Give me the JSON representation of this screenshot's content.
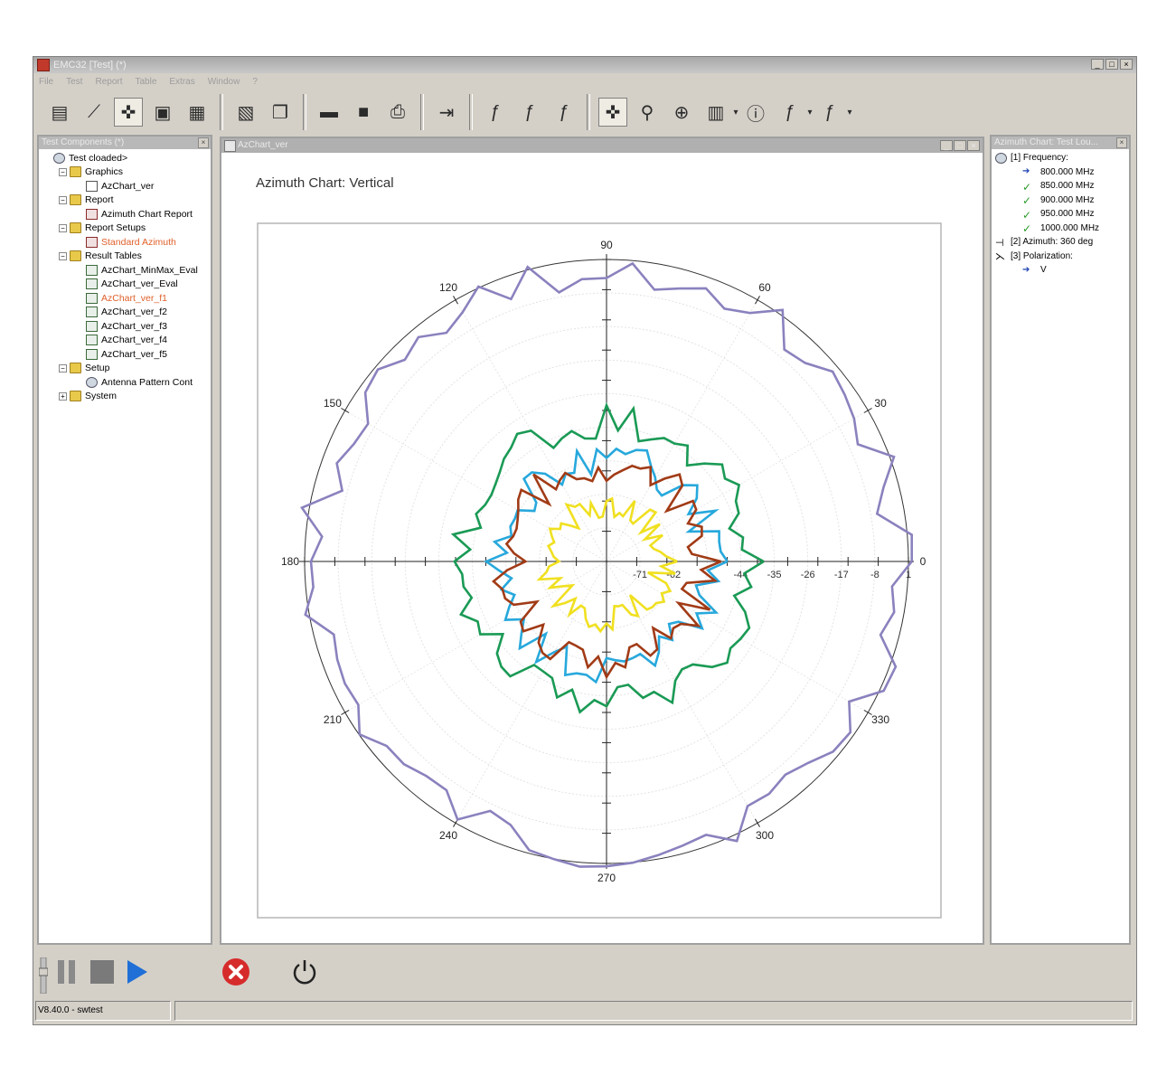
{
  "window": {
    "title": "EMC32 [Test] (*)"
  },
  "menu": [
    "File",
    "Test",
    "Report",
    "Table",
    "Extras",
    "Window",
    "?"
  ],
  "left_panel": {
    "title": "Test Components (*)",
    "items": [
      {
        "label": "Test cloaded>",
        "level": 0,
        "icon": "globe-icon",
        "toggle": ""
      },
      {
        "label": "Graphics",
        "level": 1,
        "icon": "folder-icon",
        "toggle": "−"
      },
      {
        "label": "AzChart_ver",
        "level": 2,
        "icon": "graphic-icon",
        "toggle": ""
      },
      {
        "label": "Report",
        "level": 1,
        "icon": "folder-icon",
        "toggle": "−"
      },
      {
        "label": "Azimuth Chart Report",
        "level": 2,
        "icon": "report-icon",
        "toggle": ""
      },
      {
        "label": "Report Setups",
        "level": 1,
        "icon": "folder-icon",
        "toggle": "−"
      },
      {
        "label": "Standard Azimuth",
        "level": 2,
        "icon": "report-setup-icon",
        "toggle": "",
        "highlight": true
      },
      {
        "label": "Result Tables",
        "level": 1,
        "icon": "folder-icon",
        "toggle": "−"
      },
      {
        "label": "AzChart_MinMax_Eval",
        "level": 2,
        "icon": "table-icon",
        "toggle": ""
      },
      {
        "label": "AzChart_ver_Eval",
        "level": 2,
        "icon": "table-icon",
        "toggle": ""
      },
      {
        "label": "AzChart_ver_f1",
        "level": 2,
        "icon": "table-icon",
        "toggle": "",
        "highlight": true
      },
      {
        "label": "AzChart_ver_f2",
        "level": 2,
        "icon": "table-icon",
        "toggle": ""
      },
      {
        "label": "AzChart_ver_f3",
        "level": 2,
        "icon": "table-icon",
        "toggle": ""
      },
      {
        "label": "AzChart_ver_f4",
        "level": 2,
        "icon": "table-icon",
        "toggle": ""
      },
      {
        "label": "AzChart_ver_f5",
        "level": 2,
        "icon": "table-icon",
        "toggle": ""
      },
      {
        "label": "Setup",
        "level": 1,
        "icon": "folder-icon",
        "toggle": "−"
      },
      {
        "label": "Antenna Pattern Cont",
        "level": 2,
        "icon": "antenna-icon",
        "toggle": ""
      },
      {
        "label": "System",
        "level": 1,
        "icon": "folder-icon",
        "toggle": "+"
      }
    ]
  },
  "chart_window": {
    "title": "AzChart_ver"
  },
  "right_panel": {
    "title": "Azimuth Chart: Test Lou...",
    "items": [
      {
        "label": "[1] Frequency:",
        "level": 0,
        "icon": "frequency-icon"
      },
      {
        "label": "800.000 MHz",
        "level": 1,
        "icon": "arrow-icon"
      },
      {
        "label": "850.000 MHz",
        "level": 1,
        "icon": "check-icon"
      },
      {
        "label": "900.000 MHz",
        "level": 1,
        "icon": "check-icon"
      },
      {
        "label": "950.000 MHz",
        "level": 1,
        "icon": "check-icon"
      },
      {
        "label": "1000.000 MHz",
        "level": 1,
        "icon": "check-icon"
      },
      {
        "label": "[2] Azimuth: 360 deg",
        "level": 0,
        "icon": "azimuth-icon"
      },
      {
        "label": "[3] Polarization:",
        "level": 0,
        "icon": "polarization-icon"
      },
      {
        "label": "V",
        "level": 1,
        "icon": "arrow-icon"
      }
    ]
  },
  "status": {
    "version": "V8.40.0 - swtest"
  },
  "colors": {
    "series_purple": "#8a82be",
    "series_green": "#1a9a55",
    "series_brown": "#a13b16",
    "series_blue": "#27a8dc",
    "series_yellow": "#f0e020",
    "stop_red": "#d62b2b",
    "play_blue": "#1f6fd6"
  },
  "chart_data": {
    "type": "polar-line",
    "title": "Azimuth Chart: Vertical",
    "angle_labels": [
      "0",
      "30",
      "60",
      "90",
      "120",
      "150",
      "180",
      "210",
      "240",
      "270",
      "300",
      "330"
    ],
    "radial_ticks": [
      "-71",
      "-62",
      "-44",
      "-35",
      "-26",
      "-17",
      "-8",
      "1"
    ],
    "radial_range": [
      -80,
      1
    ],
    "grid": true,
    "series": [
      {
        "color": "series_purple",
        "level": -2,
        "spread": 5
      },
      {
        "color": "series_green",
        "level": -42,
        "spread": 5
      },
      {
        "color": "series_blue",
        "level": -52,
        "spread": 5
      },
      {
        "color": "series_brown",
        "level": -54,
        "spread": 5
      },
      {
        "color": "series_yellow",
        "level": -65,
        "spread": 4
      }
    ]
  }
}
